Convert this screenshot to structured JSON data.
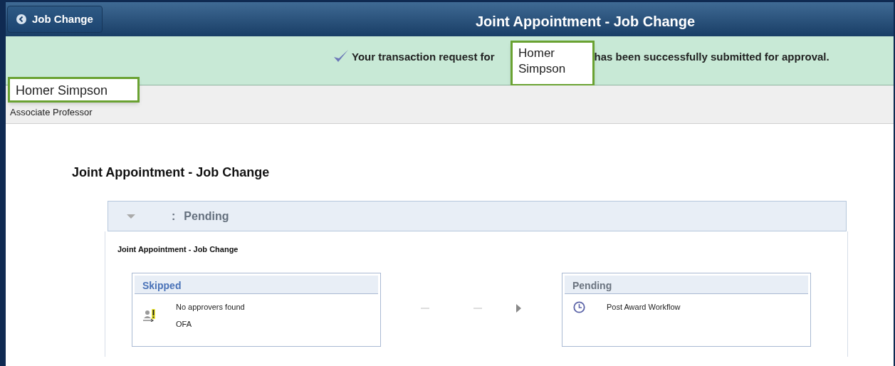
{
  "header": {
    "back_button": "Job Change",
    "title": "Joint Appointment - Job Change"
  },
  "banner": {
    "message_before": "Your transaction request for",
    "message_after": "has been successfully submitted for approval.",
    "callout": "Homer Simpson"
  },
  "employee": {
    "name": "Homer Simpson",
    "job_title": "Associate Professor"
  },
  "page_title": "Joint Appointment - Job Change",
  "approval": {
    "header_separator": ":",
    "status": "Pending",
    "expanded": true,
    "process_name": "Joint Appointment - Job Change",
    "steps": [
      {
        "status": "Skipped",
        "kind": "skipped",
        "lines": [
          "No approvers found",
          "OFA"
        ]
      },
      {
        "status": "Pending",
        "kind": "pending",
        "lines": [
          "Post Award Workflow"
        ]
      }
    ]
  }
}
